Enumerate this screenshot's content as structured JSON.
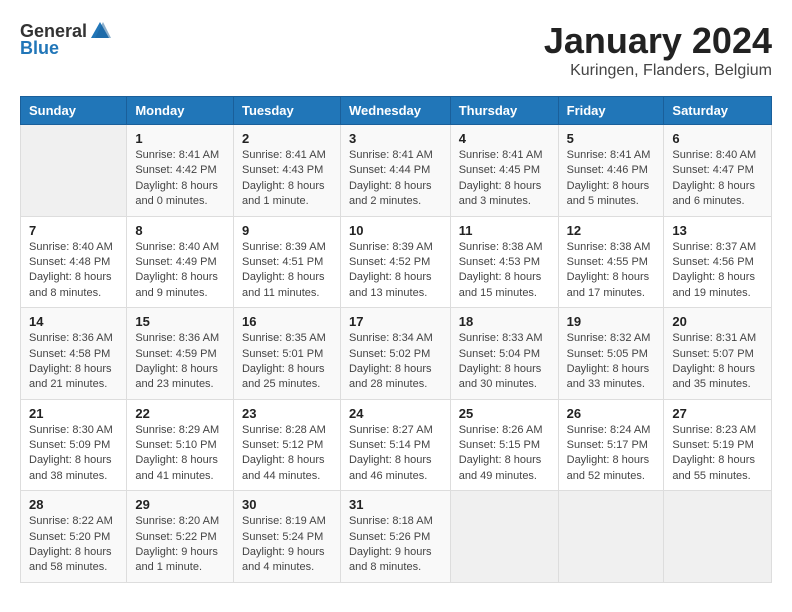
{
  "header": {
    "logo_general": "General",
    "logo_blue": "Blue",
    "month_title": "January 2024",
    "location": "Kuringen, Flanders, Belgium"
  },
  "days_of_week": [
    "Sunday",
    "Monday",
    "Tuesday",
    "Wednesday",
    "Thursday",
    "Friday",
    "Saturday"
  ],
  "weeks": [
    [
      {
        "day": "",
        "sunrise": "",
        "sunset": "",
        "daylight": "",
        "empty": true
      },
      {
        "day": "1",
        "sunrise": "Sunrise: 8:41 AM",
        "sunset": "Sunset: 4:42 PM",
        "daylight": "Daylight: 8 hours and 0 minutes."
      },
      {
        "day": "2",
        "sunrise": "Sunrise: 8:41 AM",
        "sunset": "Sunset: 4:43 PM",
        "daylight": "Daylight: 8 hours and 1 minute."
      },
      {
        "day": "3",
        "sunrise": "Sunrise: 8:41 AM",
        "sunset": "Sunset: 4:44 PM",
        "daylight": "Daylight: 8 hours and 2 minutes."
      },
      {
        "day": "4",
        "sunrise": "Sunrise: 8:41 AM",
        "sunset": "Sunset: 4:45 PM",
        "daylight": "Daylight: 8 hours and 3 minutes."
      },
      {
        "day": "5",
        "sunrise": "Sunrise: 8:41 AM",
        "sunset": "Sunset: 4:46 PM",
        "daylight": "Daylight: 8 hours and 5 minutes."
      },
      {
        "day": "6",
        "sunrise": "Sunrise: 8:40 AM",
        "sunset": "Sunset: 4:47 PM",
        "daylight": "Daylight: 8 hours and 6 minutes."
      }
    ],
    [
      {
        "day": "7",
        "sunrise": "Sunrise: 8:40 AM",
        "sunset": "Sunset: 4:48 PM",
        "daylight": "Daylight: 8 hours and 8 minutes."
      },
      {
        "day": "8",
        "sunrise": "Sunrise: 8:40 AM",
        "sunset": "Sunset: 4:49 PM",
        "daylight": "Daylight: 8 hours and 9 minutes."
      },
      {
        "day": "9",
        "sunrise": "Sunrise: 8:39 AM",
        "sunset": "Sunset: 4:51 PM",
        "daylight": "Daylight: 8 hours and 11 minutes."
      },
      {
        "day": "10",
        "sunrise": "Sunrise: 8:39 AM",
        "sunset": "Sunset: 4:52 PM",
        "daylight": "Daylight: 8 hours and 13 minutes."
      },
      {
        "day": "11",
        "sunrise": "Sunrise: 8:38 AM",
        "sunset": "Sunset: 4:53 PM",
        "daylight": "Daylight: 8 hours and 15 minutes."
      },
      {
        "day": "12",
        "sunrise": "Sunrise: 8:38 AM",
        "sunset": "Sunset: 4:55 PM",
        "daylight": "Daylight: 8 hours and 17 minutes."
      },
      {
        "day": "13",
        "sunrise": "Sunrise: 8:37 AM",
        "sunset": "Sunset: 4:56 PM",
        "daylight": "Daylight: 8 hours and 19 minutes."
      }
    ],
    [
      {
        "day": "14",
        "sunrise": "Sunrise: 8:36 AM",
        "sunset": "Sunset: 4:58 PM",
        "daylight": "Daylight: 8 hours and 21 minutes."
      },
      {
        "day": "15",
        "sunrise": "Sunrise: 8:36 AM",
        "sunset": "Sunset: 4:59 PM",
        "daylight": "Daylight: 8 hours and 23 minutes."
      },
      {
        "day": "16",
        "sunrise": "Sunrise: 8:35 AM",
        "sunset": "Sunset: 5:01 PM",
        "daylight": "Daylight: 8 hours and 25 minutes."
      },
      {
        "day": "17",
        "sunrise": "Sunrise: 8:34 AM",
        "sunset": "Sunset: 5:02 PM",
        "daylight": "Daylight: 8 hours and 28 minutes."
      },
      {
        "day": "18",
        "sunrise": "Sunrise: 8:33 AM",
        "sunset": "Sunset: 5:04 PM",
        "daylight": "Daylight: 8 hours and 30 minutes."
      },
      {
        "day": "19",
        "sunrise": "Sunrise: 8:32 AM",
        "sunset": "Sunset: 5:05 PM",
        "daylight": "Daylight: 8 hours and 33 minutes."
      },
      {
        "day": "20",
        "sunrise": "Sunrise: 8:31 AM",
        "sunset": "Sunset: 5:07 PM",
        "daylight": "Daylight: 8 hours and 35 minutes."
      }
    ],
    [
      {
        "day": "21",
        "sunrise": "Sunrise: 8:30 AM",
        "sunset": "Sunset: 5:09 PM",
        "daylight": "Daylight: 8 hours and 38 minutes."
      },
      {
        "day": "22",
        "sunrise": "Sunrise: 8:29 AM",
        "sunset": "Sunset: 5:10 PM",
        "daylight": "Daylight: 8 hours and 41 minutes."
      },
      {
        "day": "23",
        "sunrise": "Sunrise: 8:28 AM",
        "sunset": "Sunset: 5:12 PM",
        "daylight": "Daylight: 8 hours and 44 minutes."
      },
      {
        "day": "24",
        "sunrise": "Sunrise: 8:27 AM",
        "sunset": "Sunset: 5:14 PM",
        "daylight": "Daylight: 8 hours and 46 minutes."
      },
      {
        "day": "25",
        "sunrise": "Sunrise: 8:26 AM",
        "sunset": "Sunset: 5:15 PM",
        "daylight": "Daylight: 8 hours and 49 minutes."
      },
      {
        "day": "26",
        "sunrise": "Sunrise: 8:24 AM",
        "sunset": "Sunset: 5:17 PM",
        "daylight": "Daylight: 8 hours and 52 minutes."
      },
      {
        "day": "27",
        "sunrise": "Sunrise: 8:23 AM",
        "sunset": "Sunset: 5:19 PM",
        "daylight": "Daylight: 8 hours and 55 minutes."
      }
    ],
    [
      {
        "day": "28",
        "sunrise": "Sunrise: 8:22 AM",
        "sunset": "Sunset: 5:20 PM",
        "daylight": "Daylight: 8 hours and 58 minutes."
      },
      {
        "day": "29",
        "sunrise": "Sunrise: 8:20 AM",
        "sunset": "Sunset: 5:22 PM",
        "daylight": "Daylight: 9 hours and 1 minute."
      },
      {
        "day": "30",
        "sunrise": "Sunrise: 8:19 AM",
        "sunset": "Sunset: 5:24 PM",
        "daylight": "Daylight: 9 hours and 4 minutes."
      },
      {
        "day": "31",
        "sunrise": "Sunrise: 8:18 AM",
        "sunset": "Sunset: 5:26 PM",
        "daylight": "Daylight: 9 hours and 8 minutes."
      },
      {
        "day": "",
        "sunrise": "",
        "sunset": "",
        "daylight": "",
        "empty": true
      },
      {
        "day": "",
        "sunrise": "",
        "sunset": "",
        "daylight": "",
        "empty": true
      },
      {
        "day": "",
        "sunrise": "",
        "sunset": "",
        "daylight": "",
        "empty": true
      }
    ]
  ]
}
